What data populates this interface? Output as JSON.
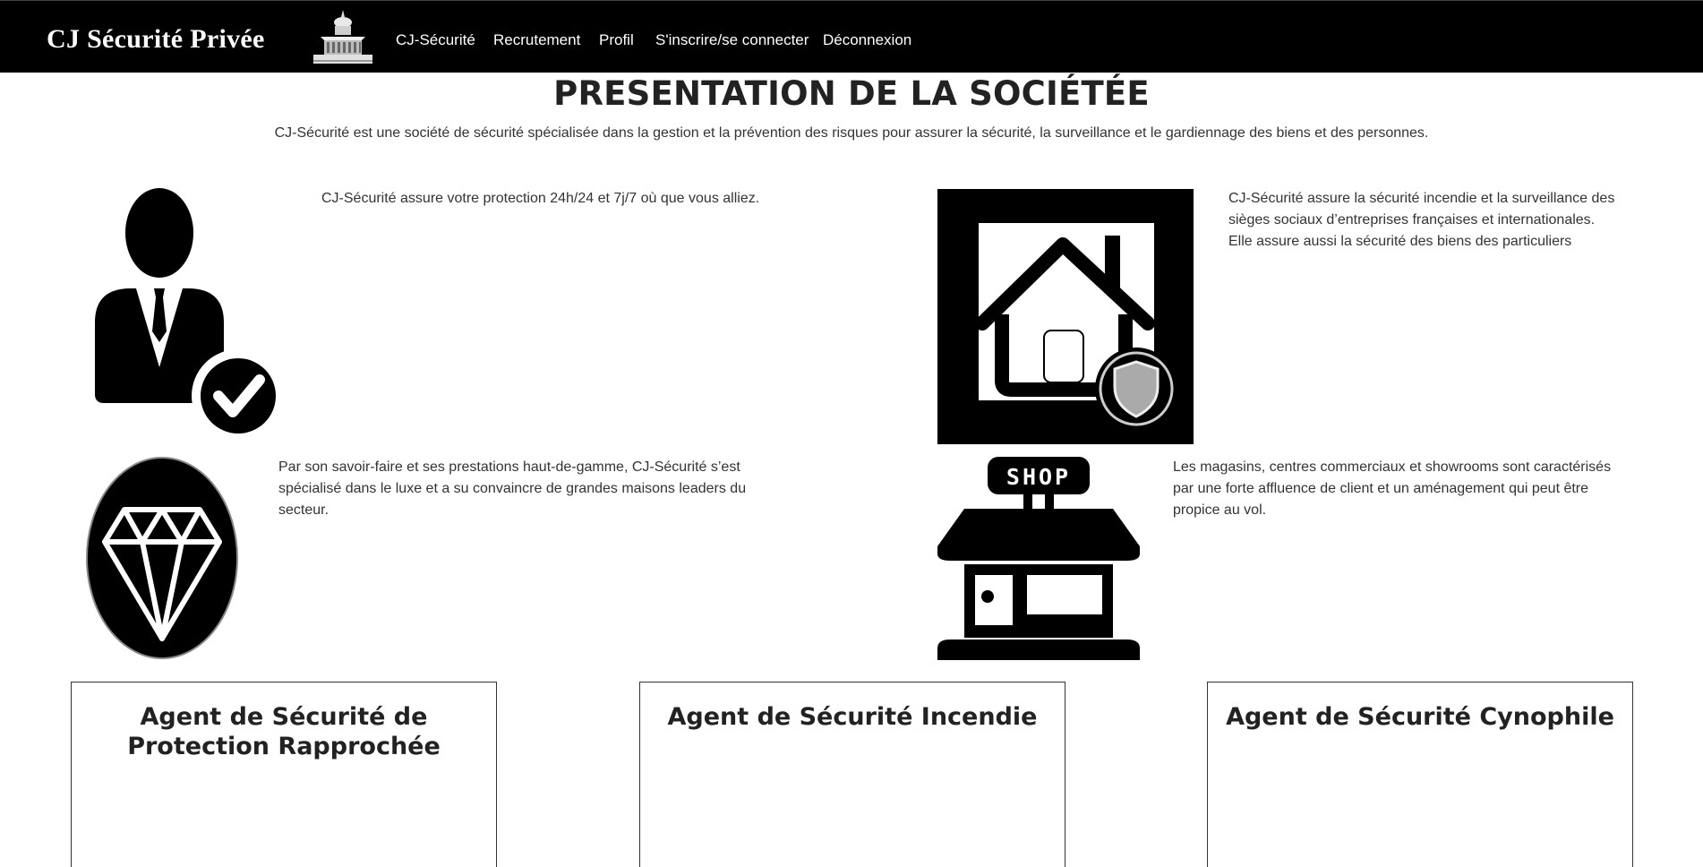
{
  "header": {
    "brand": "CJ Sécurité Privée",
    "logo_icon": "building-logo-icon",
    "nav": [
      {
        "label": "CJ-Sécurité"
      },
      {
        "label": "Recrutement"
      },
      {
        "label": "Profil"
      },
      {
        "label": "S'inscrire/se connecter"
      },
      {
        "label": "Déconnexion"
      }
    ]
  },
  "page": {
    "title": "PRESENTATION DE LA SOCIÉTÉE",
    "intro": "CJ-Sécurité est une société de sécurité spécialisée dans la gestion et la prévention des risques pour assurer la sécurité, la surveillance et le gardiennage des biens et des personnes."
  },
  "features": [
    {
      "icon": "agent-check-icon",
      "text": "CJ-Sécurité assure votre protection 24h/24 et 7j/7 où que vous alliez."
    },
    {
      "icon": "house-shield-icon",
      "lines": [
        "CJ-Sécurité assure la sécurité incendie et la surveillance des",
        "sièges sociaux d’entreprises françaises et internationales.",
        "Elle assure aussi la sécurité des biens des particuliers"
      ]
    },
    {
      "icon": "diamond-icon",
      "lines": [
        "Par son savoir-faire et ses prestations haut-de-gamme, CJ-Sécurité s’est",
        "spécialisé dans le luxe et a su convaincre de grandes maisons leaders du",
        "secteur."
      ]
    },
    {
      "icon": "shop-icon",
      "shop_sign": "SHOP",
      "lines": [
        "Les magasins, centres commerciaux et showrooms sont caractérisés",
        "par une forte affluence de client et un aménagement qui peut être",
        "propice au vol."
      ]
    }
  ],
  "cards": [
    {
      "title": "Agent de Sécurité de Protection Rapprochée"
    },
    {
      "title": "Agent de Sécurité Incendie"
    },
    {
      "title": "Agent de Sécurité Cynophile"
    }
  ],
  "colors": {
    "navbar": "#000000",
    "text": "#333333",
    "title": "#222222"
  }
}
